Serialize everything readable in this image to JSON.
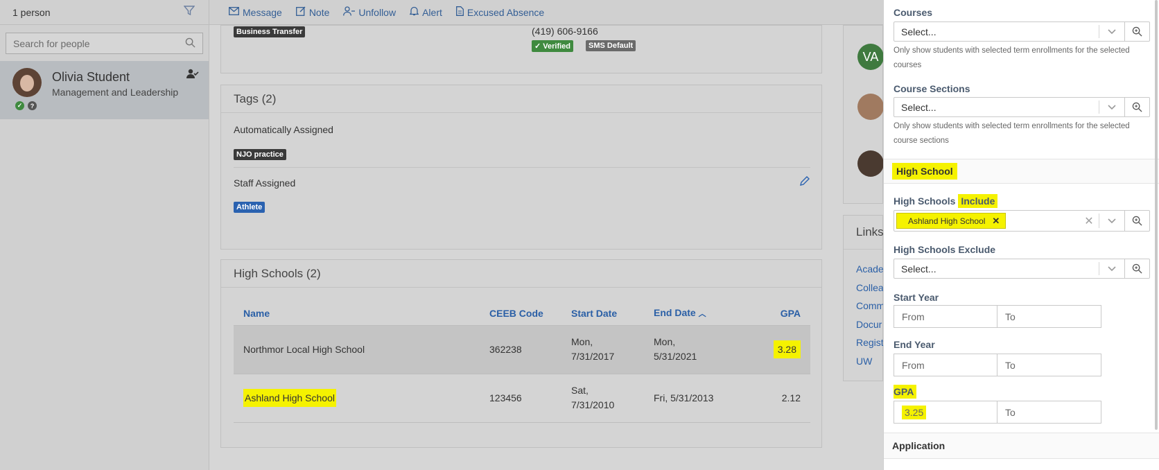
{
  "left": {
    "count": "1 person",
    "search_placeholder": "Search for people",
    "person": {
      "name": "Olivia Student",
      "program": "Management and Leadership"
    }
  },
  "topbar": {
    "actions": [
      {
        "label": "Message",
        "icon": "envelope-icon"
      },
      {
        "label": "Note",
        "icon": "note-icon"
      },
      {
        "label": "Unfollow",
        "icon": "user-minus-icon"
      },
      {
        "label": "Alert",
        "icon": "bell-icon"
      },
      {
        "label": "Excused Absence",
        "icon": "document-icon"
      }
    ]
  },
  "contact": {
    "tag": "Business Transfer",
    "phone": "(419) 606-9166",
    "verified": "✓ Verified",
    "sms": "SMS Default"
  },
  "tags": {
    "title": "Tags (2)",
    "auto_label": "Automatically Assigned",
    "auto_tag": "NJO practice",
    "staff_label": "Staff Assigned",
    "staff_tag": "Athlete"
  },
  "high_schools": {
    "title": "High Schools (2)",
    "columns": [
      "Name",
      "CEEB Code",
      "Start Date",
      "End Date",
      "GPA"
    ],
    "rows": [
      {
        "name": "Northmor Local High School",
        "ceeb": "362238",
        "start": "Mon, 7/31/2017",
        "end": "Mon, 5/31/2021",
        "gpa": "3.28"
      },
      {
        "name": "Ashland High School",
        "ceeb": "123456",
        "start": "Sat, 7/31/2010",
        "end": "Fri, 5/31/2013",
        "gpa": "2.12"
      }
    ]
  },
  "right_strip": {
    "initials": "VA",
    "links_title": "Links",
    "links": [
      "Acade",
      "Collea",
      "Comm",
      "Docur",
      "Regist",
      "UW"
    ]
  },
  "panel": {
    "courses_label": "Courses",
    "courses_value": "Select...",
    "courses_help": "Only show students with selected term enrollments for the selected courses",
    "sections_label": "Course Sections",
    "sections_value": "Select...",
    "sections_help": "Only show students with selected term enrollments for the selected course sections",
    "high_school_header": "High School",
    "include_label_a": "High Schools",
    "include_label_b": "Include",
    "include_chip": "Ashland High School",
    "exclude_label": "High Schools Exclude",
    "exclude_value": "Select...",
    "start_year_label": "Start Year",
    "end_year_label": "End Year",
    "from": "From",
    "to": "To",
    "gpa_label": "GPA",
    "gpa_from": "3.25",
    "application_header": "Application"
  }
}
